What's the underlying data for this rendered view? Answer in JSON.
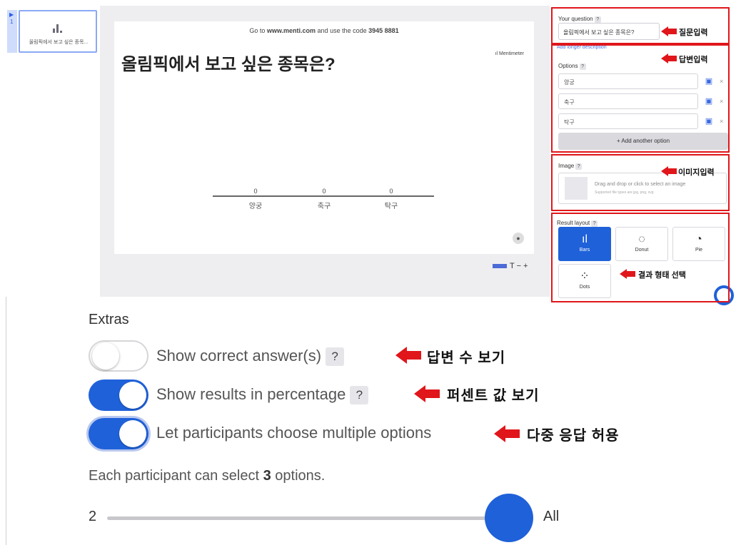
{
  "slides": {
    "items": [
      {
        "number": "1",
        "thumb_label": "올림픽에서 보고 싶은 종목..."
      }
    ]
  },
  "slide": {
    "join_prefix": "Go to ",
    "join_site": "www.menti.com",
    "join_middle": " and use the code ",
    "join_code": "3945 8881",
    "brand": "Mentimeter",
    "question_title": "올림픽에서 보고 싶은 종목은?",
    "bars": [
      {
        "label": "양궁",
        "count": "0"
      },
      {
        "label": "축구",
        "count": "0"
      },
      {
        "label": "탁구",
        "count": "0"
      }
    ],
    "tools_text": "T  − +"
  },
  "panel": {
    "question_label": "Your question",
    "question_value": "올림픽에서 보고 싶은 종목은?",
    "add_description": "Add longer description",
    "options_label": "Options",
    "options": [
      "양궁",
      "축구",
      "탁구"
    ],
    "add_option": "+ Add another option",
    "image_label": "Image",
    "image_drop_text": "Drag and drop or click to select an image",
    "image_supported": "Supported file types are jpg, png, svg",
    "result_layout_label": "Result layout",
    "layouts": [
      {
        "name": "Bars",
        "selected": true
      },
      {
        "name": "Donut",
        "selected": false
      },
      {
        "name": "Pie",
        "selected": false
      },
      {
        "name": "Dots",
        "selected": false
      }
    ]
  },
  "annotations": {
    "question_input": "질문입력",
    "answer_input": "답변입력",
    "image_input": "이미지입력",
    "result_layout": "결과 형태 선택",
    "show_correct": "답변 수 보기",
    "show_percentage": "퍼센트 값 보기",
    "multiple": "다중 응답 허용"
  },
  "extras": {
    "title": "Extras",
    "toggles": [
      {
        "label": "Show correct answer(s)",
        "on": false,
        "help": "?"
      },
      {
        "label": "Show results in percentage",
        "on": true,
        "help": "?"
      },
      {
        "label": "Let participants choose multiple options",
        "on": true,
        "help": ""
      }
    ],
    "select_prefix": "Each participant can select ",
    "select_count": "3",
    "select_suffix": " options.",
    "slider_min": "2",
    "slider_max": "All"
  },
  "colors": {
    "accent": "#1f61d9",
    "annotation_red": "#e0161b"
  }
}
